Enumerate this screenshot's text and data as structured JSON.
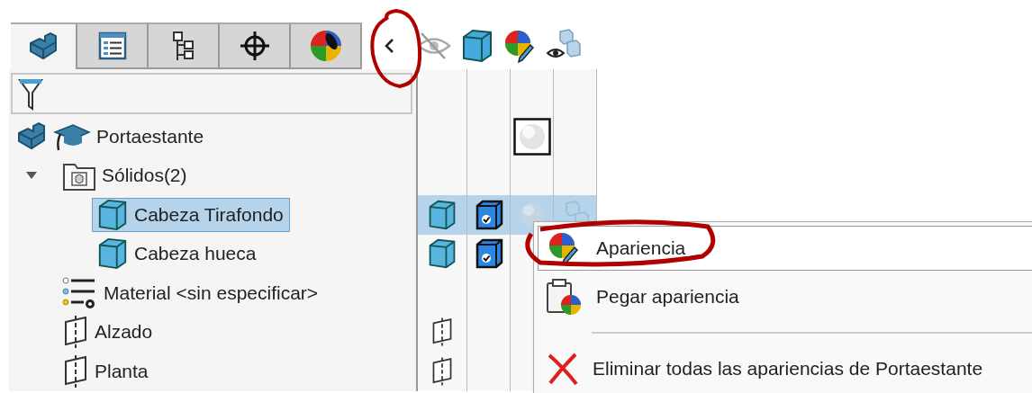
{
  "tabs": [
    {
      "kind": "part",
      "selected": true
    },
    {
      "kind": "properties",
      "selected": false
    },
    {
      "kind": "config",
      "selected": false
    },
    {
      "kind": "dimxpert",
      "selected": false
    },
    {
      "kind": "appearance",
      "selected": false
    }
  ],
  "display_header": [
    {
      "kind": "hide"
    },
    {
      "kind": "display-mode"
    },
    {
      "kind": "appearance"
    },
    {
      "kind": "transparency"
    }
  ],
  "tree": [
    {
      "label": "Portaestante",
      "kind": "part",
      "selected": false,
      "display": [
        {
          "kind": "none"
        },
        {
          "kind": "none"
        },
        {
          "kind": "sphere"
        }
      ],
      "children": [
        {
          "label": "Sólidos(2)",
          "kind": "folder",
          "expanded": true,
          "selected": false,
          "children": [
            {
              "label": "Cabeza Tirafondo",
              "kind": "body",
              "selected": true,
              "display": [
                {
                  "kind": "cube"
                },
                {
                  "kind": "solid"
                },
                {
                  "kind": "sphere-faded"
                },
                {
                  "kind": "cubes-faded"
                }
              ]
            },
            {
              "label": "Cabeza hueca",
              "kind": "body",
              "selected": false,
              "display": [
                {
                  "kind": "cube"
                },
                {
                  "kind": "solid"
                }
              ]
            }
          ]
        },
        {
          "label": "Material <sin especificar>",
          "kind": "material",
          "selected": false
        },
        {
          "label": "Alzado",
          "kind": "plane",
          "selected": false,
          "display": [
            {
              "kind": "plane"
            }
          ]
        },
        {
          "label": "Planta",
          "kind": "plane",
          "selected": false,
          "display": [
            {
              "kind": "plane"
            }
          ]
        }
      ]
    }
  ],
  "context_menu": [
    {
      "kind": "appearance",
      "label": "Apariencia",
      "selected": true
    },
    {
      "kind": "paste",
      "label": "Pegar apariencia",
      "selected": false
    },
    {
      "kind": "separator"
    },
    {
      "kind": "delete",
      "label": "Eliminar todas las apariencias de Portaestante",
      "selected": false
    }
  ]
}
